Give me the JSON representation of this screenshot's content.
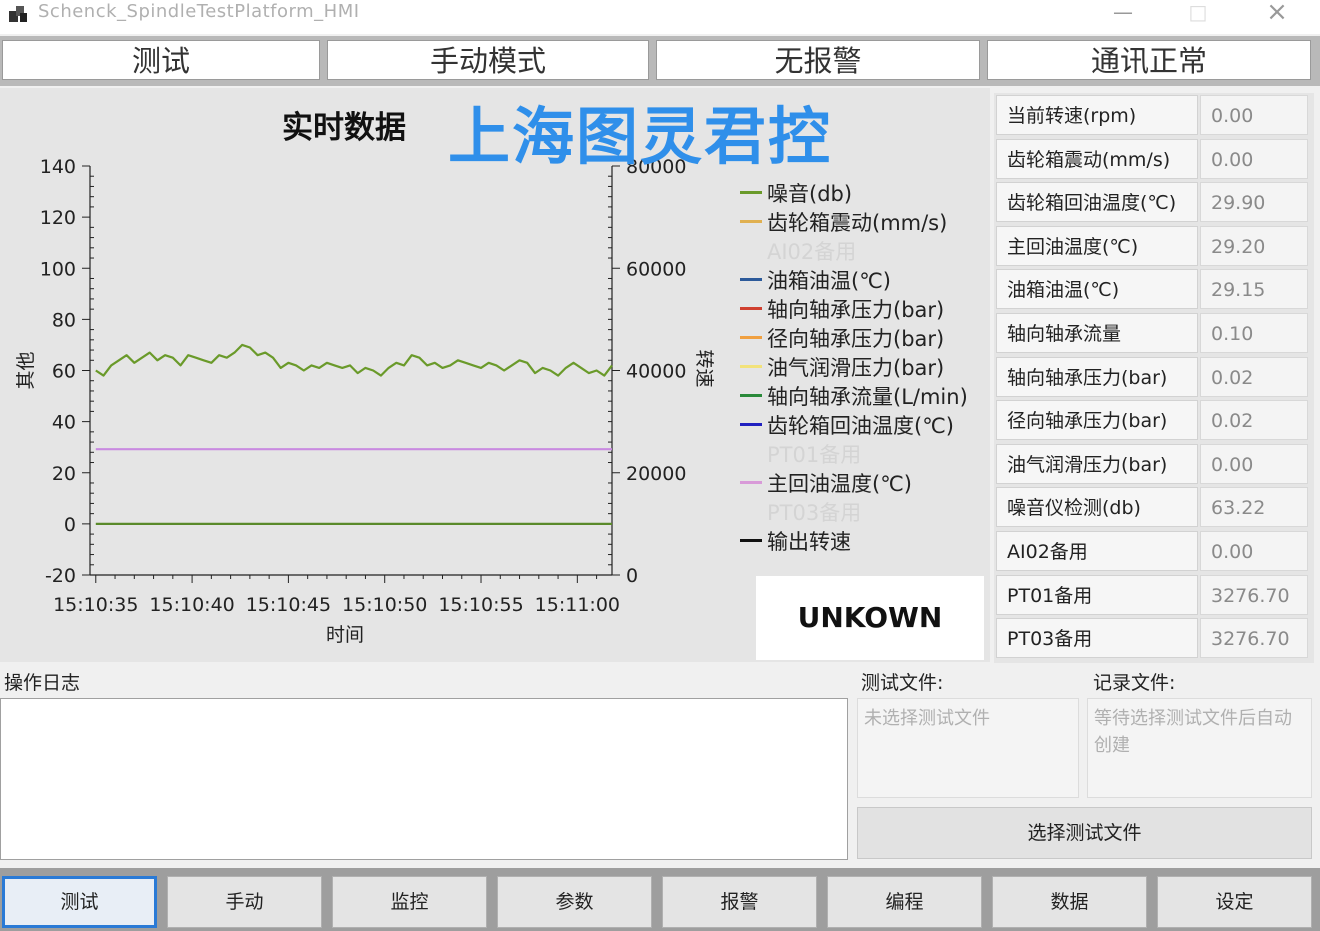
{
  "window": {
    "title": "Schenck_SpindleTestPlatform_HMI",
    "minimize_glyph": "—",
    "maximize_glyph": "□",
    "close_glyph": "×"
  },
  "status_bar": {
    "items": [
      "测试",
      "手动模式",
      "无报警",
      "通讯正常"
    ]
  },
  "chart": {
    "title": "实时数据",
    "watermark": "上海图灵君控",
    "status_box": "UNKOWN"
  },
  "chart_data": {
    "type": "line",
    "xlabel": "时间",
    "ylabel_left": "其他",
    "ylabel_right": "转速",
    "x_ticks": [
      "15:10:35",
      "15:10:40",
      "15:10:45",
      "15:10:50",
      "15:10:55",
      "15:11:00"
    ],
    "ylim_left": [
      -20,
      140
    ],
    "yticks_left": [
      -20,
      0,
      20,
      40,
      60,
      80,
      100,
      120,
      140
    ],
    "ylim_right": [
      0,
      80000
    ],
    "yticks_right": [
      0,
      20000,
      40000,
      60000,
      80000
    ],
    "legend_position": "right",
    "legend": [
      {
        "name": "噪音(db)",
        "color": "#6a9a2a",
        "faded": false
      },
      {
        "name": "齿轮箱震动(mm/s)",
        "color": "#e0b050",
        "faded": false
      },
      {
        "name": "AI02备用",
        "color": "#e5e5e5",
        "faded": true
      },
      {
        "name": "油箱油温(℃)",
        "color": "#2c5a9a",
        "faded": false
      },
      {
        "name": "轴向轴承压力(bar)",
        "color": "#d04030",
        "faded": false
      },
      {
        "name": "径向轴承压力(bar)",
        "color": "#f0a040",
        "faded": false
      },
      {
        "name": "油气润滑压力(bar)",
        "color": "#f2e27a",
        "faded": false
      },
      {
        "name": "轴向轴承流量(L/min)",
        "color": "#2a8a3a",
        "faded": false
      },
      {
        "name": "齿轮箱回油温度(℃)",
        "color": "#2020c0",
        "faded": false
      },
      {
        "name": "PT01备用",
        "color": "#e5e5e5",
        "faded": true
      },
      {
        "name": "主回油温度(℃)",
        "color": "#d89ad8",
        "faded": false
      },
      {
        "name": "PT03备用",
        "color": "#e5e5e5",
        "faded": true
      },
      {
        "name": "输出转速",
        "color": "#111111",
        "faded": false
      }
    ],
    "series": [
      {
        "name": "噪音(db)",
        "axis": "left",
        "color": "#6a9a2a",
        "t": [
          0,
          0.4,
          0.8,
          1.2,
          1.6,
          2.0,
          2.4,
          2.8,
          3.2,
          3.6,
          4.0,
          4.4,
          4.8,
          5.2,
          5.6,
          6.0,
          6.4,
          6.8,
          7.2,
          7.6,
          8.0,
          8.4,
          8.8,
          9.2,
          9.6,
          10.0,
          10.4,
          10.8,
          11.2,
          11.6,
          12.0,
          12.4,
          12.8,
          13.2,
          13.6,
          14.0,
          14.4,
          14.8,
          15.2,
          15.6,
          16.0,
          16.4,
          16.8,
          17.2,
          17.6,
          18.0,
          18.4,
          18.8,
          19.2,
          19.6,
          20.0,
          20.4,
          20.8,
          21.2,
          21.6,
          22.0,
          22.4,
          22.8,
          23.2,
          23.6,
          24.0,
          24.4,
          24.8,
          25.2,
          25.6,
          26.0,
          26.4,
          26.8
        ],
        "values": [
          60,
          58,
          62,
          64,
          66,
          63,
          65,
          67,
          64,
          66,
          65,
          62,
          66,
          65,
          64,
          63,
          66,
          65,
          67,
          70,
          69,
          66,
          67,
          65,
          61,
          63,
          62,
          60,
          62,
          61,
          63,
          62,
          61,
          62,
          59,
          61,
          60,
          58,
          61,
          63,
          62,
          66,
          65,
          62,
          63,
          61,
          62,
          64,
          63,
          62,
          61,
          63,
          62,
          60,
          62,
          64,
          63,
          59,
          61,
          60,
          58,
          61,
          63,
          61,
          59,
          60,
          58,
          62
        ],
        "approximate": true
      },
      {
        "name": "主回油温度(℃)",
        "axis": "left",
        "color": "#c98ae0",
        "t": [
          0,
          26.8
        ],
        "values": [
          29.2,
          29.2
        ]
      },
      {
        "name": "轴向轴承流量(L/min)",
        "axis": "left",
        "color": "#5a8a2a",
        "t": [
          0,
          26.8
        ],
        "values": [
          0,
          0
        ]
      }
    ],
    "x_tick_offsets_seconds": [
      0,
      5,
      10,
      15,
      20,
      25
    ],
    "x_range_seconds": [
      -0.3,
      26.8
    ]
  },
  "readings": [
    {
      "label": "当前转速(rpm)",
      "value": "0.00"
    },
    {
      "label": "齿轮箱震动(mm/s)",
      "value": "0.00"
    },
    {
      "label": "齿轮箱回油温度(℃)",
      "value": "29.90"
    },
    {
      "label": "主回油温度(℃)",
      "value": "29.20"
    },
    {
      "label": "油箱油温(℃)",
      "value": "29.15"
    },
    {
      "label": "轴向轴承流量",
      "value": "0.10"
    },
    {
      "label": "轴向轴承压力(bar)",
      "value": "0.02"
    },
    {
      "label": "径向轴承压力(bar)",
      "value": "0.02"
    },
    {
      "label": "油气润滑压力(bar)",
      "value": "0.00"
    },
    {
      "label": "噪音仪检测(db)",
      "value": "63.22"
    },
    {
      "label": "AI02备用",
      "value": "0.00"
    },
    {
      "label": "PT01备用",
      "value": "3276.70"
    },
    {
      "label": "PT03备用",
      "value": "3276.70"
    }
  ],
  "log": {
    "header": "操作日志",
    "content": ""
  },
  "files": {
    "test_file_label": "测试文件:",
    "test_file_value": "未选择测试文件",
    "record_file_label": "记录文件:",
    "record_file_value": "等待选择测试文件后自动创建",
    "select_button": "选择测试文件"
  },
  "nav": {
    "items": [
      "测试",
      "手动",
      "监控",
      "参数",
      "报警",
      "编程",
      "数据",
      "设定"
    ],
    "active_index": 0
  },
  "colors": {
    "accent": "#2a7ad6",
    "watermark": "#2f8fea",
    "panel_bg": "#e5e5e5"
  }
}
